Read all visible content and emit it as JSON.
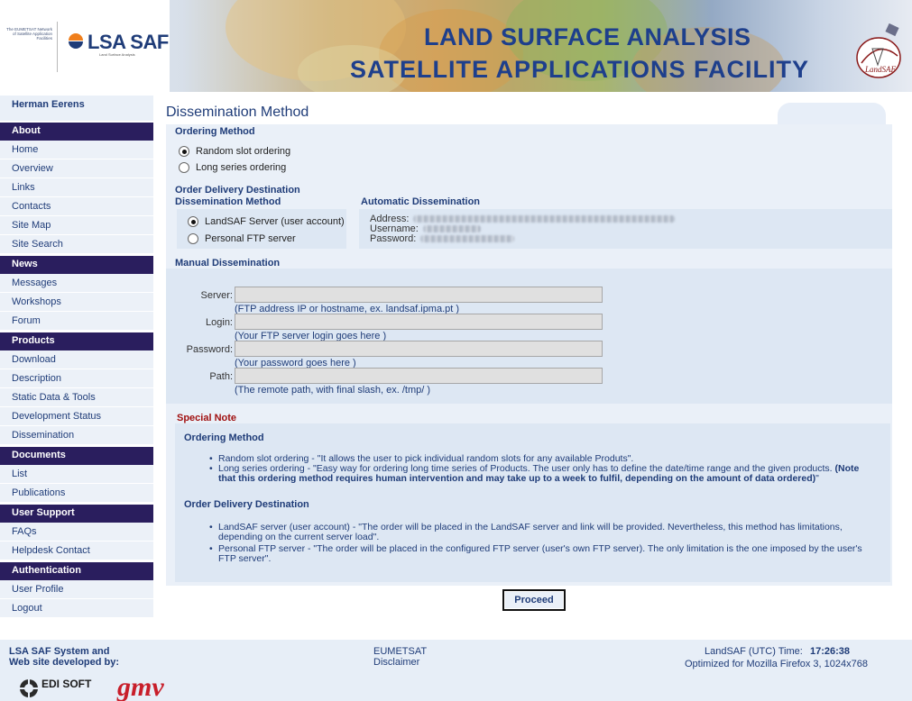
{
  "header": {
    "org_text": "The EUMETSAT Network of Satellite Application Facilities",
    "logo_name": "LSA SAF",
    "logo_sub": "Land Surface Analysis",
    "title_line1": "LAND SURFACE ANALYSIS",
    "title_line2": "SATELLITE APPLICATIONS FACILITY",
    "emblem_text": "LandSAF"
  },
  "sidebar": {
    "user_name": "Herman Eerens",
    "sections": [
      {
        "title": "About",
        "items": [
          "Home",
          "Overview",
          "Links",
          "Contacts",
          "Site Map",
          "Site Search"
        ]
      },
      {
        "title": "News",
        "items": [
          "Messages",
          "Workshops",
          "Forum"
        ]
      },
      {
        "title": "Products",
        "items": [
          "Download",
          "Description",
          "Static Data & Tools",
          "Development Status",
          "Dissemination"
        ]
      },
      {
        "title": "Documents",
        "items": [
          "List",
          "Publications"
        ]
      },
      {
        "title": "User Support",
        "items": [
          "FAQs",
          "Helpdesk Contact"
        ]
      },
      {
        "title": "Authentication",
        "items": [
          "User Profile",
          "Logout"
        ]
      }
    ]
  },
  "main": {
    "page_title": "Dissemination Method",
    "ordering_method": {
      "heading": "Ordering Method",
      "options": [
        {
          "label": "Random slot ordering",
          "selected": true
        },
        {
          "label": "Long series ordering",
          "selected": false
        }
      ]
    },
    "delivery": {
      "heading": "Order Delivery Destination",
      "method_heading": "Dissemination Method",
      "options": [
        {
          "label": "LandSAF Server (user account)",
          "selected": true
        },
        {
          "label": "Personal FTP server",
          "selected": false
        }
      ],
      "auto_heading": "Automatic Dissemination",
      "address_label": "Address:",
      "username_label": "Username:",
      "password_label": "Password:"
    },
    "manual": {
      "heading": "Manual Dissemination",
      "server_label": "Server:",
      "server_value": "",
      "server_hint": "(FTP address IP or hostname, ex. landsaf.ipma.pt )",
      "login_label": "Login:",
      "login_value": "",
      "login_hint": "(Your FTP server login goes here )",
      "password_label": "Password:",
      "password_value": "",
      "password_hint": "(Your password goes here )",
      "path_label": "Path:",
      "path_value": "",
      "path_hint": "(The remote path, with final slash, ex. /tmp/ )"
    },
    "special_note": {
      "title": "Special Note",
      "ordering_heading": "Ordering Method",
      "ordering_bullet1": "Random slot ordering - \"It allows the user to pick individual random slots for any available Produts\".",
      "ordering_bullet2_line1_normal": "Long series ordering - \"Easy way for ordering long time series of Products. The user only has to define the date/time range and the given products.",
      "ordering_bullet2_line1_bold": "(Note",
      "ordering_bullet2_line2_bold": "that this ordering method requires human intervention and may take up to a week to fulfil, depending on the amount of data ordered)",
      "ordering_bullet2_line2_end": "\"",
      "delivery_heading": "Order Delivery Destination",
      "delivery_bullet1_line1": "LandSAF server (user account) - \"The order will be placed in the LandSAF server and link will be provided. Nevertheless, this method has limitations,",
      "delivery_bullet1_line2": "depending on the current server load\".",
      "delivery_bullet2_line1": "Personal FTP server - \"The order will be placed in the configured FTP server (user's own FTP server). The only limitation is the one imposed by the user's",
      "delivery_bullet2_line2": "FTP server\"."
    },
    "proceed_label": "Proceed"
  },
  "footer": {
    "developed_line1": "LSA SAF System and",
    "developed_line2": "Web site developed by:",
    "link1": "EUMETSAT",
    "link2": "Disclaimer",
    "time_label": "LandSAF (UTC) Time:",
    "time_value": "17:26:38",
    "optimized": "Optimized for Mozilla Firefox 3, 1024x768",
    "edisoft_text": "EDI SOFT",
    "gmv_text": "gmv"
  },
  "colors": {
    "nav_header": "#2a1e5e",
    "link": "#1f3c78",
    "panel": "#eaf0f8",
    "special_note": "#a01010"
  }
}
